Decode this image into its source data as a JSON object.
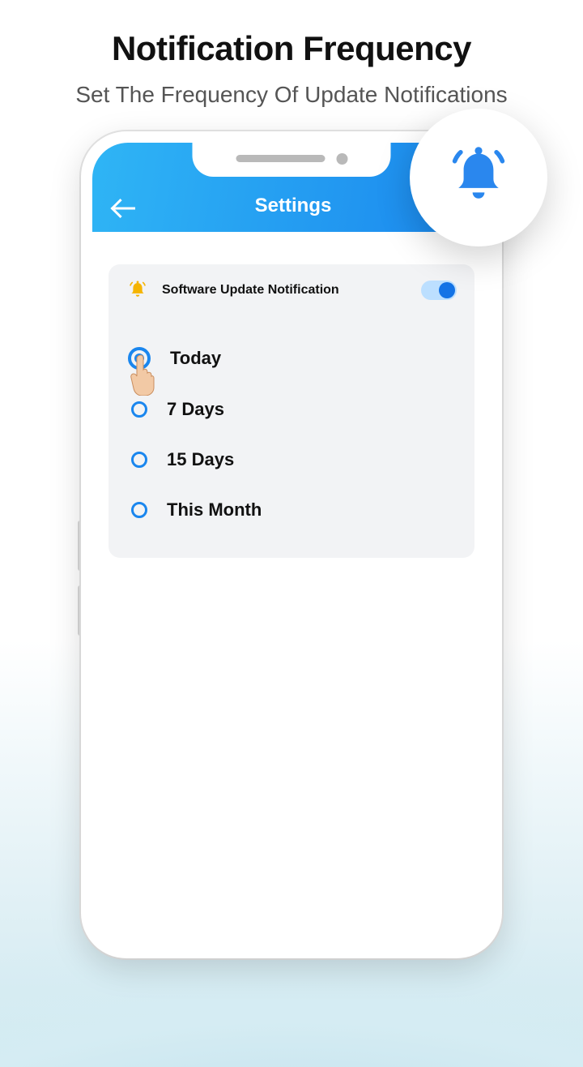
{
  "page": {
    "title": "Notification Frequency",
    "subtitle": "Set The Frequency Of Update Notifications"
  },
  "header": {
    "title": "Settings"
  },
  "card": {
    "toggle_label": "Software Update Notification",
    "toggle_on": true
  },
  "options": [
    {
      "label": "Today",
      "selected": true
    },
    {
      "label": "7 Days",
      "selected": false
    },
    {
      "label": "15 Days",
      "selected": false
    },
    {
      "label": "This Month",
      "selected": false
    }
  ],
  "icons": {
    "back": "back-arrow-icon",
    "bell_yellow": "bell-icon",
    "bell_floating": "bell-icon"
  }
}
